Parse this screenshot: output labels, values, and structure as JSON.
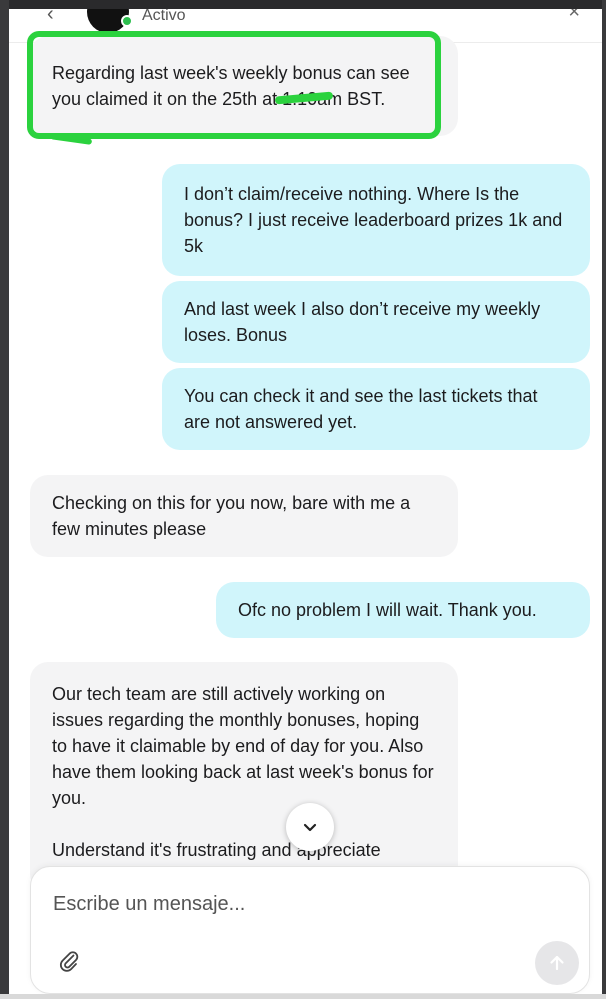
{
  "header": {
    "status": "Activo"
  },
  "messages": [
    {
      "from": "agent",
      "text": "Regarding last week's weekly bonus can see you claimed it on the 25th at 1:10am BST."
    },
    {
      "from": "user",
      "text": "I don’t claim/receive nothing. Where Is the bonus? I just receive leaderboard prizes 1k and 5k"
    },
    {
      "from": "user",
      "text": "And last week I also don’t receive my weekly loses. Bonus"
    },
    {
      "from": "user",
      "text": "You can check it and see the last tickets that are not answered yet."
    },
    {
      "from": "agent",
      "text": "Checking on this for you now, bare with me a few minutes please"
    },
    {
      "from": "user",
      "text": "Ofc no problem I will wait. Thank you."
    },
    {
      "from": "agent",
      "text": "Our tech team are still actively working on issues regarding the monthly bonuses, hoping to have it claimable by end of day for you. Also have them looking back at last week's bonus for you."
    },
    {
      "from": "agent",
      "text": "Understand it's frustrating and appreciate"
    }
  ],
  "composer": {
    "placeholder": "Escribe un mensaje..."
  },
  "colors": {
    "agent_bubble": "#f4f4f5",
    "user_bubble": "#d0f5fb",
    "online": "#2dbe4e",
    "annotation": "#2bd23e"
  },
  "icons": {
    "back": "chevron-left-icon",
    "close": "close-icon",
    "scroll": "chevron-down-icon",
    "attach": "paperclip-icon",
    "send": "arrow-up-icon"
  }
}
